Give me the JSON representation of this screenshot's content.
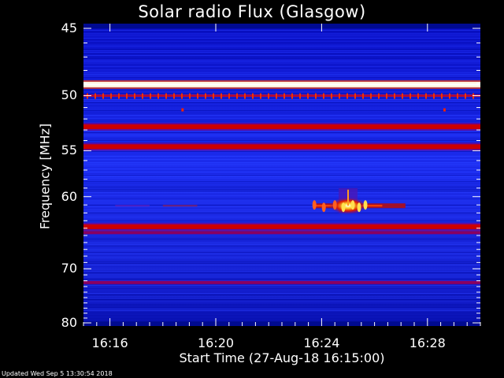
{
  "chart_data": {
    "type": "heatmap",
    "title": "Solar radio Flux (Glasgow)",
    "xlabel": "Start Time (27-Aug-18 16:15:00)",
    "ylabel": "Frequency [MHz]",
    "x_ticks": [
      "16:16",
      "16:20",
      "16:24",
      "16:28"
    ],
    "x_tick_minutes": [
      16,
      20,
      24,
      28
    ],
    "x_range_minutes": [
      15,
      30
    ],
    "y_ticks": [
      45,
      50,
      55,
      60,
      70,
      80
    ],
    "ylim": [
      45,
      80
    ],
    "y_scale": "reciprocal",
    "colormap": [
      "#00009a",
      "#1a2cf0",
      "#cc0000",
      "#ffcc00",
      "#ffffff"
    ],
    "bands_mhz": [
      {
        "freq": 49.1,
        "level": "white"
      },
      {
        "freq": 50.0,
        "level": "red-dotted"
      },
      {
        "freq": 52.7,
        "level": "red"
      },
      {
        "freq": 54.6,
        "level": "red"
      },
      {
        "freq": 63.8,
        "level": "red"
      },
      {
        "freq": 64.6,
        "level": "dark-red"
      },
      {
        "freq": 72.3,
        "level": "dark-red"
      }
    ],
    "burst": {
      "time_start": "16:23:40",
      "time_end": "16:27:10",
      "freq_low": 59.0,
      "freq_high": 62.0,
      "peak_time": "16:25:00",
      "peak_freq": 61.1
    }
  },
  "footer": {
    "updated": "Updated Wed Sep  5 13:30:54 2018"
  }
}
